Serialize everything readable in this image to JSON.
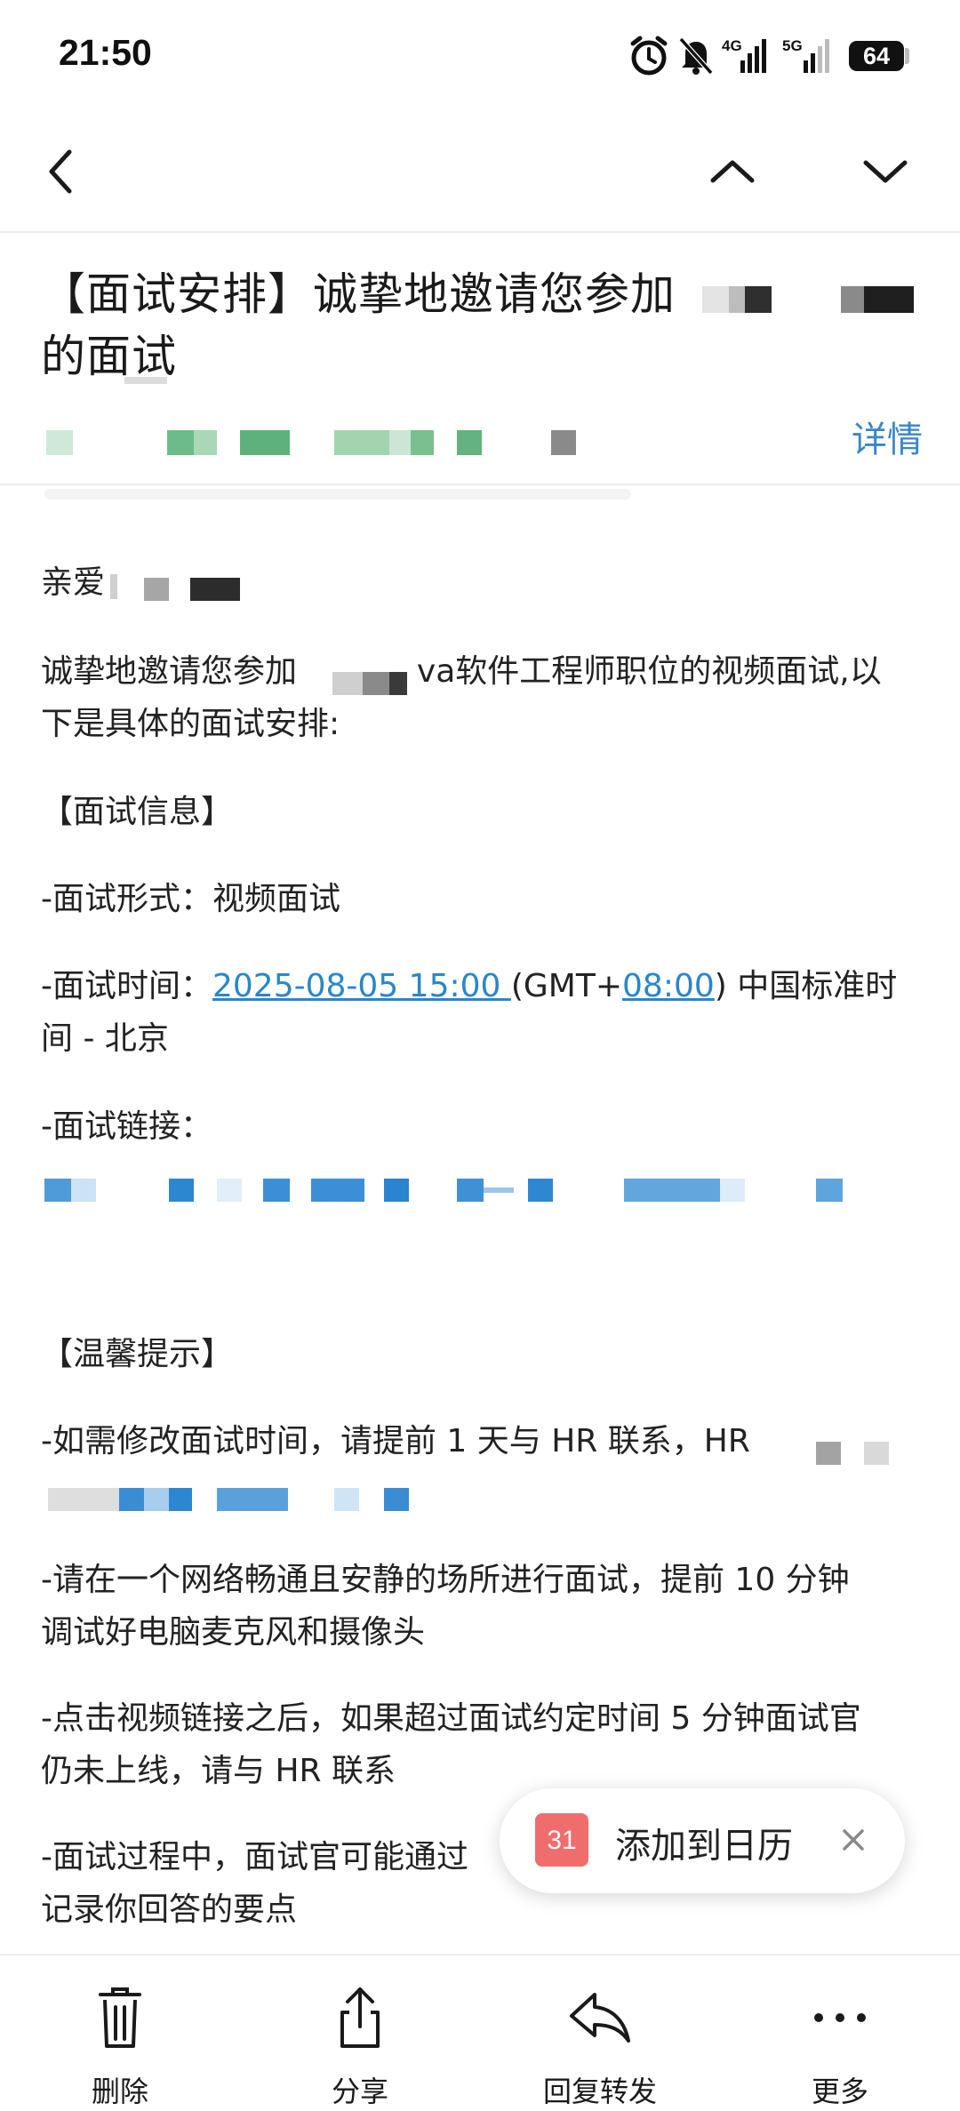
{
  "status_bar": {
    "time": "21:50",
    "signal_1_label": "4G",
    "signal_2_label": "5G",
    "battery": "64",
    "icons": [
      "alarm-icon",
      "mute-icon",
      "signal-4g-icon",
      "signal-5g-icon",
      "battery-icon"
    ]
  },
  "nav": {
    "icons": [
      "back-icon",
      "previous-mail-icon",
      "next-mail-icon"
    ]
  },
  "email": {
    "subject_line1": "【面试安排】诚挚地邀请您参加",
    "subject_line2": "的面试",
    "details_label": "详情",
    "greeting": "亲爱",
    "intro_part1": "诚挚地邀请您参加",
    "intro_part2": "va软件工程师职位的视频面试,以",
    "intro_line2": "下是具体的面试安排:",
    "section_info": "【面试信息】",
    "format_line": "-面试形式：视频面试",
    "time_prefix": "-面试时间：",
    "time_link": "2025-08-05 15:00 ",
    "time_mid": "(GMT+",
    "time_link2": "08:00",
    "time_suffix": ") 中国标准时",
    "time_line2": "间 - 北京",
    "link_label": "-面试链接：",
    "section_tips": "【温馨提示】",
    "tip1_line1": "-如需修改面试时间，请提前 1 天与 HR 联系，HR",
    "tip2_line1": "-请在一个网络畅通且安静的场所进行面试，提前 10 分钟",
    "tip2_line2": "调试好电脑麦克风和摄像头",
    "tip3_line1": "-点击视频链接之后，如果超过面试约定时间 5 分钟面试官",
    "tip3_line2": "仍未上线，请与 HR 联系",
    "tip4_line1": "-面试过程中，面试官可能通过",
    "tip4_line2": "记录你回答的要点"
  },
  "calendar_toast": {
    "day": "31",
    "label": "添加到日历"
  },
  "bottom_bar": {
    "delete": "删除",
    "share": "分享",
    "reply_forward": "回复转发",
    "more": "更多"
  },
  "colors": {
    "accent_blue": "#2a86c9",
    "calendar_red": "#f06d6d",
    "redaction_green": "#5cb87c"
  }
}
